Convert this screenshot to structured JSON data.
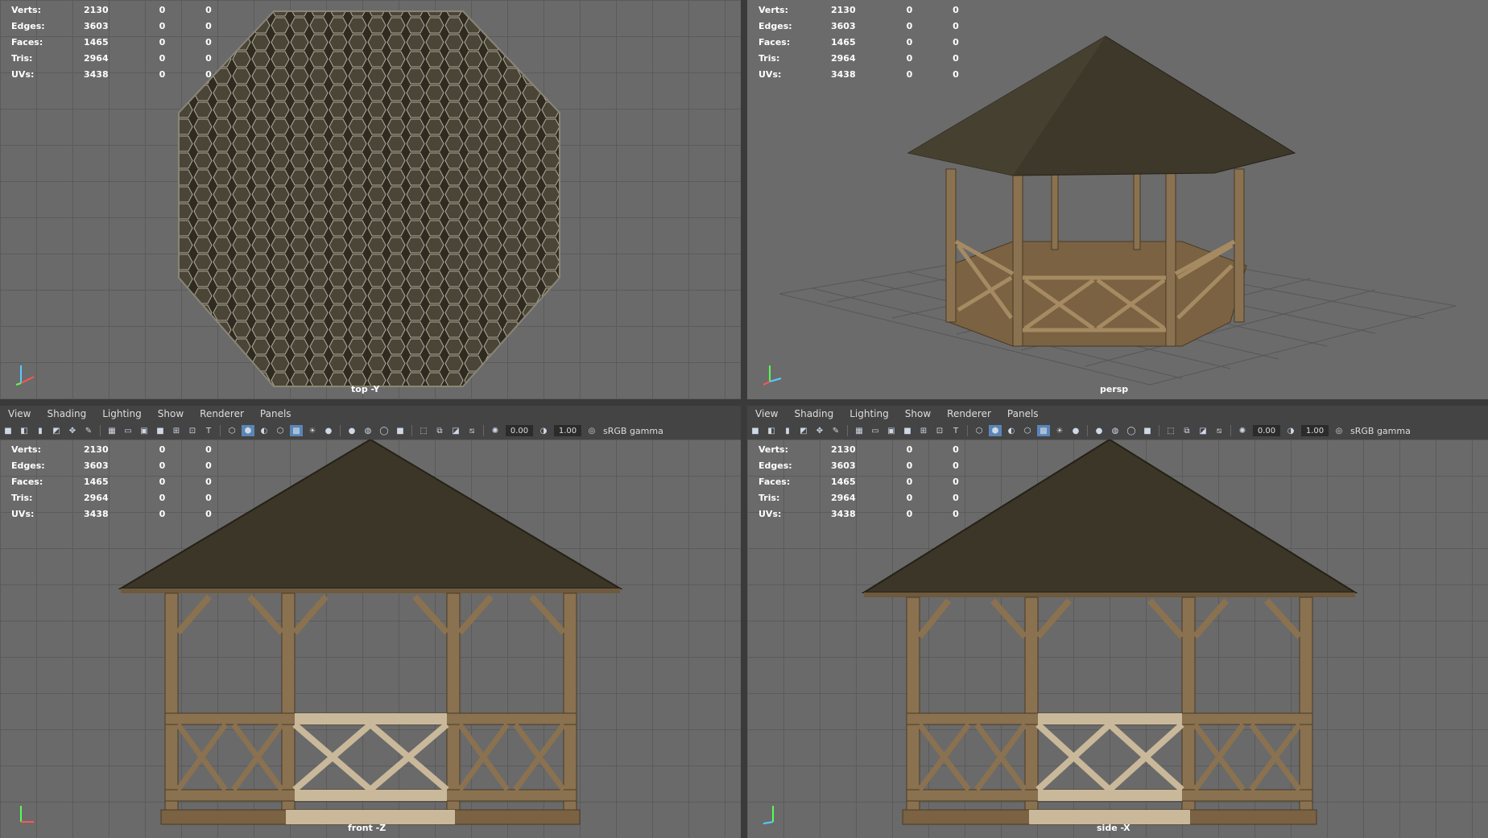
{
  "hud": {
    "labels": [
      "Verts:",
      "Edges:",
      "Faces:",
      "Tris:",
      "UVs:"
    ],
    "values": [
      [
        "2130",
        "0",
        "0"
      ],
      [
        "3603",
        "0",
        "0"
      ],
      [
        "1465",
        "0",
        "0"
      ],
      [
        "2964",
        "0",
        "0"
      ],
      [
        "3438",
        "0",
        "0"
      ]
    ]
  },
  "viewports": {
    "top": {
      "camera": "top -Y"
    },
    "persp": {
      "camera": "persp"
    },
    "front": {
      "camera": "front -Z"
    },
    "side": {
      "camera": "side -X"
    }
  },
  "menu": [
    "View",
    "Shading",
    "Lighting",
    "Show",
    "Renderer",
    "Panels"
  ],
  "toolbar": {
    "exposure": "0.00",
    "gamma": "1.00",
    "colorspace": "sRGB gamma"
  },
  "colors": {
    "roof": "#3a3527",
    "wood": "#8a7150",
    "wood_light": "#c9b89a",
    "grid_bg": "#6a6a6a"
  }
}
